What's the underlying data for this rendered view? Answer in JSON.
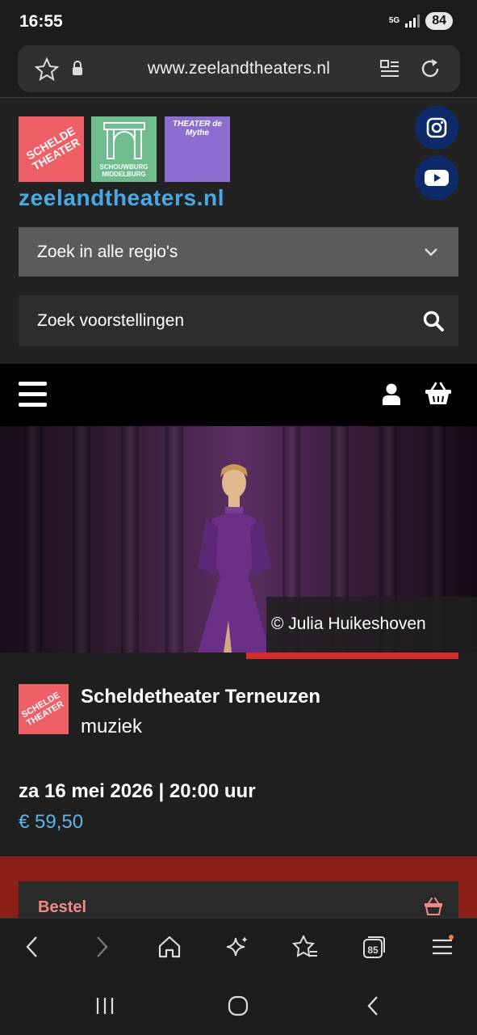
{
  "status_bar": {
    "time": "16:55",
    "network": "5G",
    "battery": "84"
  },
  "browser": {
    "url": "www.zeelandtheaters.nl",
    "tab_count": "85",
    "icons": [
      "star-icon",
      "lock-icon",
      "reader-icon",
      "reload-icon"
    ]
  },
  "site": {
    "title": "zeelandtheaters.nl",
    "logos": {
      "schelde": "SCHELDE THEATER",
      "schouwburg": "SCHOUWBURG MIDDELBURG",
      "mythe": "THEATER de Mythe"
    },
    "region_select": "Zoek in alle regio's",
    "search_placeholder": "Zoek voorstellingen"
  },
  "hero": {
    "copyright": "© Julia Huikeshoven"
  },
  "event": {
    "venue": "Scheldetheater Terneuzen",
    "genre": "muziek",
    "datetime": "za 16 mei 2026 | 20:00 uur",
    "price": "€ 59,50",
    "order_label": "Bestel"
  },
  "colors": {
    "brand_blue": "#49a8e6",
    "accent_red": "#d82b2b",
    "price_blue": "#5eb4e6",
    "order_band": "#8a1f17"
  }
}
